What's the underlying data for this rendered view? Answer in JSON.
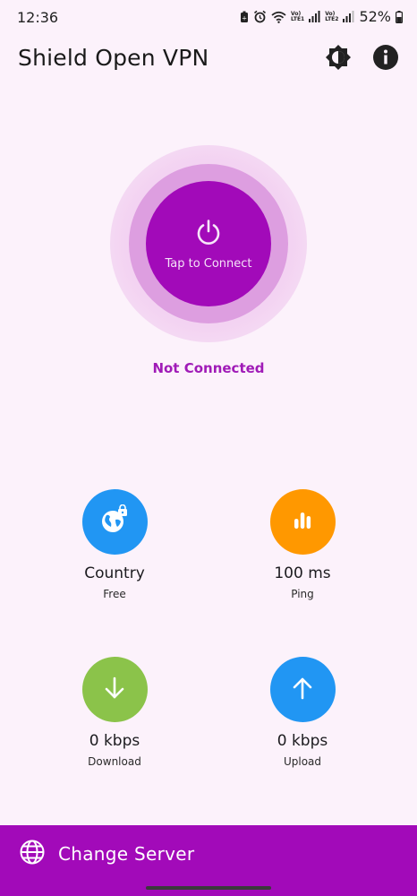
{
  "status_bar": {
    "time": "12:36",
    "battery": "52%",
    "sim1_label_top": "Vo)",
    "sim1_label_bottom": "LTE1",
    "sim2_label_top": "Vo)",
    "sim2_label_bottom": "LTE2"
  },
  "app": {
    "title": "Shield Open VPN"
  },
  "connect": {
    "button_label": "Tap to Connect",
    "status": "Not Connected"
  },
  "stats": {
    "country": {
      "value": "Country",
      "label": "Free",
      "icon": "globe-lock-icon",
      "color": "#2196f3"
    },
    "ping": {
      "value": "100 ms",
      "label": "Ping",
      "icon": "bar-chart-icon",
      "color": "#ff9800"
    },
    "download": {
      "value": "0 kbps",
      "label": "Download",
      "icon": "arrow-down-icon",
      "color": "#8bc34a"
    },
    "upload": {
      "value": "0 kbps",
      "label": "Upload",
      "icon": "arrow-up-icon",
      "color": "#2196f3"
    }
  },
  "bottom": {
    "label": "Change Server",
    "icon": "globe-icon"
  },
  "colors": {
    "accent": "#a20ab9",
    "background": "#fcf2fb"
  }
}
